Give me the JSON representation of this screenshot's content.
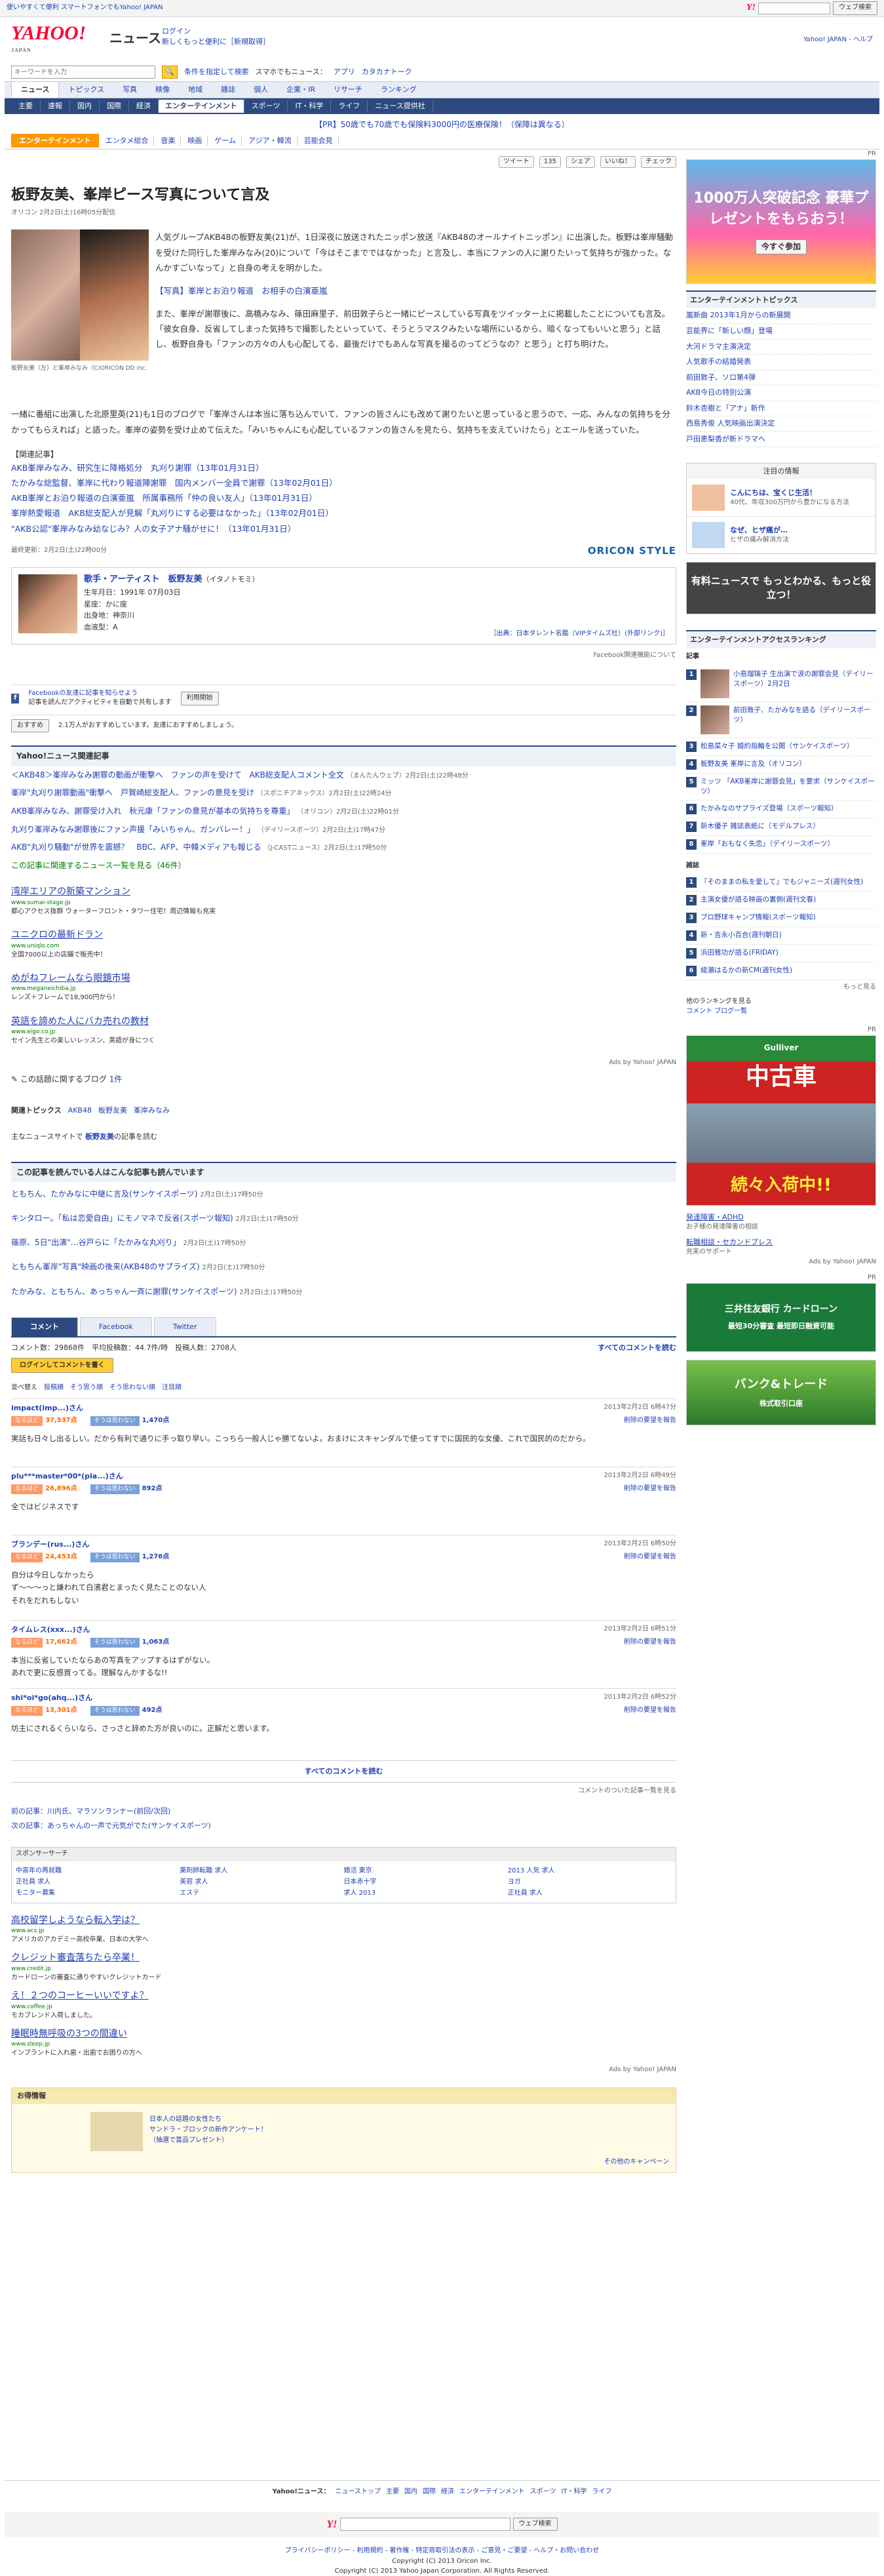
{
  "topbar": {
    "left": "使いやすくて便利 スマートフォンでもYahoo! JAPAN",
    "right_button": "ウェブ検索"
  },
  "masthead": {
    "logo": "YAHOO!",
    "logo_sub": "JAPAN",
    "service": "ニュース",
    "login": "ログイン",
    "login_sub": "新しくもっと便利に［新規取得］",
    "right": "Yahoo! JAPAN - ヘルプ"
  },
  "search": {
    "placeholder": "キーワードを入力",
    "advanced": "条件を指定して検索",
    "mobile": "スマホでもニュース：",
    "apps": [
      "アプリ",
      "カタカナトーク"
    ]
  },
  "gnav": [
    "ニュース",
    "トピックス",
    "写真",
    "映像",
    "地域",
    "雑誌",
    "個人",
    "企業・IR",
    "リサーチ",
    "ランキング"
  ],
  "subnav": [
    "主要",
    "速報",
    "国内",
    "国際",
    "経済",
    "エンターテインメント",
    "スポーツ",
    "IT・科学",
    "ライフ",
    "ニュース提供社"
  ],
  "promo": "【PR】50歳でも70歳でも保険料3000円の医療保険！（保障は異なる）",
  "catbar": {
    "active": "エンターテインメント",
    "items": [
      "エンタメ総合",
      "音楽",
      "映画",
      "ゲーム",
      "アジア・韓流",
      "芸能会見"
    ]
  },
  "social": {
    "tweet": "ツイート",
    "count": "135",
    "share": "シェア",
    "like": "いいね！",
    "check": "チェック"
  },
  "article": {
    "title": "板野友美、峯岸ピース写真について言及",
    "meta": "オリコン 2月2日(土)16時05分配信",
    "caption": "板野友美（左）と峯岸みなみ（C)ORICON DD inc.",
    "para1": "人気グループAKB48の板野友美(21)が、1日深夜に放送されたニッポン放送『AKB48のオールナイトニッポン』に出演した。板野は峯岸騒動を受けた同行した峯岸みなみ(20)について「今はそこまでではなかった」と言及し、本当にファンの人に謝りたいって気持ちが強かった。なんかすごいなって」と自身の考えを明かした。",
    "link1": "【写真】峯岸とお泊り報道　お相手の白濱亜嵐",
    "para2": "また、峯岸が謝罪後に、高橋みなみ、篠田麻里子、前田敦子らと一緒にピースしている写真をツイッター上に掲載したことについても言及。「彼女自身、反省してしまった気持ちで撮影したといっていて、そうとうマスクみたいな場所にいるから、暗くなってもいいと思う」と話し、板野自身も「ファンの方々の人も心配してる、最後だけでもあんな写真を撮るのってどうなの？と思う」と打ち明けた。",
    "para3": "一緒に番組に出演した北原里英(21)も1日のブログで「峯岸さんは本当に落ち込んでいて、ファンの皆さんにも改めて謝りたいと思っていると思うので、一応、みんなの気持ちを分かってもらえれば」と語った。峯岸の姿勢を受け止めて伝えた。「みいちゃんにも心配しているファンの皆さんを見たら、気持ちを支えていけたら」とエールを送っていた。",
    "related_head": "【関連記事】",
    "related": [
      "AKB峯岸みなみ、研究生に降格処分　丸刈り謝罪（13年01月31日）",
      "たかみな総監督、峯岸に代わり報道陣謝罪　国内メンバー全員で謝罪（13年02月01日）",
      "AKB峯岸とお泊り報道の白濱亜嵐　所属事務所「仲の良い友人」（13年01月31日）",
      "峯岸熱愛報道　AKB総支配人が見解「丸刈りにする必要はなかった」（13年02月01日）",
      "\"AKB公認\"峯岸みなみ幼なじみ？人の女子アナ騒がせに！（13年01月31日）"
    ],
    "updated": "最終更新：2月2日(土)22時00分",
    "oricon": "ORICON STYLE"
  },
  "artist": {
    "name": "歌手・アーティスト　板野友美",
    "kana": "（イタノトモミ）",
    "born": "生年月日：1991年 07月03日",
    "sign": "星座：かに座",
    "place": "出身地：神奈川",
    "blood": "血液型：A",
    "source": "［出典：日本タレント名鑑（VIPタイムズ社）(外部リンク)］"
  },
  "facebook": {
    "text": "Facebookの友達に記事を知らせよう",
    "sub": "記事を読んだアクティビティを自動で共有します",
    "btn": "利用開始",
    "related": "Facebook関連機能について",
    "rec": "おすすめ",
    "rec_count": "2.1万人がおすすめしています。友達におすすめしましょう。"
  },
  "related_news": {
    "title": "Yahoo!ニュース関連記事",
    "items": [
      {
        "t": "＜AKB48＞峯岸みなみ謝罪の動画が衝撃へ　ファンの声を受けて　AKB総支配人コメント全文",
        "src": "（まんたんウェブ）2月2日(土)22時48分"
      },
      {
        "t": "峯岸\"丸刈り謝罪動画\"衝撃へ　戸賀崎総支配人、ファンの意見を受け",
        "src": "（スポニチアネックス）2月2日(土)22時24分"
      },
      {
        "t": "AKB峯岸みなみ、謝罪受け入れ　秋元康「ファンの意見が基本の気持ちを尊重」",
        "src": "（オリコン）2月2日(土)22時01分"
      },
      {
        "t": "丸刈り峯岸みなみ謝罪後にファン声援「みいちゃん、ガンバレー！」",
        "src": "（デイリースポーツ）2月2日(土)17時47分"
      },
      {
        "t": "AKB\"丸刈り騒動\"が世界を震撼？　BBC、AFP、中韓メディアも報じる",
        "src": "（J-CASTニュース）2月2日(土)17時50分"
      }
    ],
    "more": "この記事に関連するニュース一覧を見る（46件）"
  },
  "ads_main": [
    {
      "h": "湾岸エリアの新築マンション",
      "u": "www.sumai-stage.jp",
      "d": "都心アクセス抜群 ウォーターフロント・タワー住宅！周辺情報も充実"
    },
    {
      "h": "ユニクロの最新ドラン",
      "u": "www.uniqlo.com",
      "d": "全国7000以上の店舗で販売中！"
    },
    {
      "h": "めがねフレームなら眼鏡市場",
      "u": "www.meganeichiba.jp",
      "d": "レンズ＋フレームで18,900円から！"
    },
    {
      "h": "英語を諦めた人にバカ売れの教材",
      "u": "www.eigo.co.jp",
      "d": "セイン先生との楽しいレッスン、英語が身につく"
    }
  ],
  "ads_label": "Ads by Yahoo! JAPAN",
  "blog": {
    "label": "この話題に関するブログ",
    "count": "1件"
  },
  "topics": {
    "label": "関連トピックス",
    "items": [
      "AKB48",
      "板野友美",
      "峯岸みなみ"
    ]
  },
  "other": {
    "label": "主なニュースサイトで",
    "name": "板野友美",
    "suffix": "の記事を読む"
  },
  "also_read": {
    "title": "この記事を読んでいる人はこんな記事も読んでいます",
    "items": [
      {
        "t": "ともちん、たかみなに中継に言及(サンケイスポーツ)",
        "d": "2月2日(土)17時50分"
      },
      {
        "t": "キンタロー。「私は恋愛自由」にモノマネで反省(スポーツ報知)",
        "d": "2月2日(土)17時50分"
      },
      {
        "t": "篠原、5日\"出演\"…谷戸らに「たかみな丸刈り」",
        "d": "2月2日(土)17時50分"
      },
      {
        "t": "ともちん峯岸\"写真\"映画の後来(AKB48のサプライズ)",
        "d": "2月2日(土)17時50分"
      },
      {
        "t": "たかみな、ともちん、あっちゃん一斉に謝罪(サンケイスポーツ)",
        "d": "2月2日(土)17時50分"
      }
    ]
  },
  "comments": {
    "tabs": [
      "コメント",
      "Facebook",
      "Twitter"
    ],
    "sort": "並べ替え",
    "orders": [
      "投稿順",
      "そう思う順",
      "そう思わない順",
      "注目順"
    ],
    "count_label": "コメント数：29868件　平均投稿数：44.7件/時　投稿人数：2708人",
    "all_link": "すべてのコメントを読む",
    "login": "ログインしてコメントを書く",
    "items": [
      {
        "user": "impact(imp...)さん",
        "date": "2013年2月2日 6時47分",
        "agree": "37,537点",
        "disagree": "1,470点",
        "text": "実話も日々し出るしい。だから有利で通りに手っ取り早い。こっちら一般人じゃ勝てないよ。おまけにスキャンダルで使ってすでに国民的な女優、これで国民的のだから。"
      },
      {
        "user": "plu***master*00*(pla...)さん",
        "date": "2013年2月2日 6時49分",
        "agree": "26,896点",
        "disagree": "892点",
        "text": "全ではビジネスです"
      },
      {
        "user": "ブランデー(rus...)さん",
        "date": "2013年2月2日 6時50分",
        "agree": "24,453点",
        "disagree": "1,276点",
        "text": "自分は今日しなかったら\nず～～～っと嫌われて白濱君とまったく見たことのない人\nそれをだれもしない"
      },
      {
        "user": "タイムレス(xxx...)さん",
        "date": "2013年2月2日 6時51分",
        "agree": "17,662点",
        "disagree": "1,063点",
        "text": "本当に反省していたならあの写真をアップするはずがない。\nあれで更に反感買ってる。理解なんかするな!!"
      },
      {
        "user": "shi*oi*go(ahq...)さん",
        "date": "2013年2月2日 6時52分",
        "agree": "13,301点",
        "disagree": "492点",
        "text": "坊主にされるくらいなら、さっさと辞めた方が良いのに。正解だと思います。"
      }
    ],
    "all": "すべてのコメントを読む",
    "list": "コメントのついた記事一覧を見る",
    "vote_up": "なるほど",
    "vote_down": "そうは思わない",
    "del": "削除の要望を報告"
  },
  "prevnext": {
    "prev": "前の記事：川内氏、マラソンランナー(前回/次回)",
    "next": "次の記事：あっちゃんの一声で元気がでた(サンケイスポーツ)"
  },
  "sponsor": {
    "title": "スポンサーサーチ",
    "links": [
      "中高年の再就職",
      "薬剤師転職 求人",
      "婚活 東京",
      "2013 人気 求人",
      "正社員 求人",
      "美容 求人",
      "日本赤十字",
      "ヨガ",
      "モニター募集",
      "エステ",
      "求人 2013",
      "正社員 求人"
    ]
  },
  "ads_bottom": [
    {
      "h": "高校留学しようなら転入学は？",
      "u": "www.acs.jp",
      "d": "アメリカのアカデミー高校卒業、日本の大学へ"
    },
    {
      "h": "クレジット審査落ちたら卒業！",
      "u": "www.credit.jp",
      "d": "カードローンの審査に通りやすいクレジットカード"
    },
    {
      "h": "え！２つのコーヒーいいですよ？",
      "u": "www.coffee.jp",
      "d": "モカブレンド入荷しました。"
    },
    {
      "h": "睡眠時無呼吸の3つの間違い",
      "u": "www.sleep.jp",
      "d": "インプラントに入れ歯・出歯でお困りの方へ"
    }
  ],
  "campaign": {
    "title": "お得情報",
    "items": [
      "日本人の話題の女性たち",
      "サンドラ・ブロックの新作アンケート！",
      "（抽選で賞品プレゼント）"
    ],
    "link": "その他のキャンペーン"
  },
  "footer": {
    "nav_label": "Yahoo!ニュース：",
    "nav": [
      "ニューストップ",
      "主要",
      "国内",
      "国際",
      "経済",
      "エンターテインメント",
      "スポーツ",
      "IT・科学",
      "ライフ"
    ],
    "search_btn": "ウェブ検索",
    "links": "プライバシーポリシー - 利用規約 - 著作権 - 特定商取引法の表示 - ご意見・ご要望 - ヘルプ・お問い合わせ",
    "copy1": "Copyright (C) 2013 Oricon Inc.",
    "copy2": "Copyright (C) 2013 Yahoo Japan Corporation. All Rights Reserved."
  },
  "side": {
    "pr": "PR",
    "banner1": "1000万人突破記念 豪華プレゼントをもらおう！",
    "banner1_btn": "今すぐ参加",
    "topics_title": "エンターテインメントトピックス",
    "topics": [
      "嵐新曲 2013年1月からの新展開",
      "芸能界に「新しい顔」登場",
      "大河ドラマ主演決定",
      "人気歌手の結婚発表",
      "前田敦子、ソロ第4弾",
      "AKB今日の特別公演",
      "鈴木杏樹と「アナ」新作",
      "西島秀俊 人気映画出演決定",
      "戸田恵梨香が新ドラマへ"
    ],
    "chumoku": "注目の情報",
    "pr_items": [
      {
        "h": "こんにちは、宝くじ生活！",
        "d": "40代、年収300万円から豊かになる方法"
      },
      {
        "h": "なぜ、ヒザ痛が…",
        "d": "ヒザの痛み解消方法"
      }
    ],
    "yuryo": "有料ニュースで もっとわかる、もっと役立つ！",
    "ranking_title": "エンターテインメントアクセスランキング",
    "ranking_sub": "記事",
    "ranking": [
      "小島瑠璃子 生出演で涙の謝罪会見（デイリースポーツ）2月2日",
      "前田敦子、たかみなを語る（デイリースポーツ）",
      "松島菜々子 婚約指輪を公開（サンケイスポーツ）",
      "板野友美 峯岸に言及（オリコン）",
      "ミッツ 「AKB峯岸に謝罪会見」を要求（サンケイスポーツ）",
      "たかみなのサプライズ登場（スポーツ報知）",
      "新木優子 雑誌表紙に（モデルプレス）",
      "峯岸「おもなく失恋」（デイリースポーツ）"
    ],
    "zasshi": "雑誌",
    "zasshi_items": [
      "「そのままの私を愛して」でもジャニーズ(週刊女性)",
      "主演女優が語る映画の裏側(週刊文春)",
      "プロ野球キャンプ情報(スポーツ報知)",
      "新・吉永小百合(週刊朝日)",
      "浜田雅功が語る(FRIDAY)",
      "綾瀬はるかの新CM(週刊女性)"
    ],
    "more": "もっと見る",
    "other_label": "他のランキングを見る",
    "other": [
      "コメント",
      "ブログ一覧"
    ],
    "gulliver": "中古車",
    "gulliver_sub": "続々入荷中!!",
    "gulliver_logo": "Gulliver",
    "ad_links": [
      {
        "h": "発達障害・ADHD",
        "d": "お子様の発達障害の相談"
      },
      {
        "h": "転職相談・セカンドプレス",
        "d": "充実のサポート"
      }
    ],
    "loan": "三井住友銀行 カードローン",
    "loan_sub": "最短30分審査 最短即日融資可能",
    "bank": "バンク&トレード",
    "bank_sub": "株式取引口座"
  }
}
